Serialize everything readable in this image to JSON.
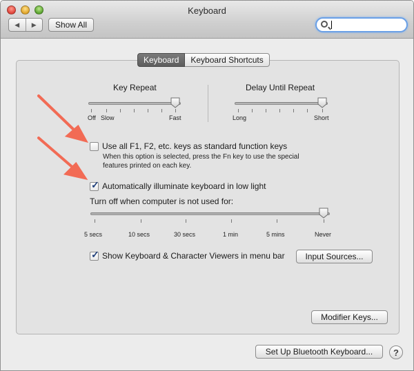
{
  "window": {
    "title": "Keyboard"
  },
  "toolbar": {
    "back_icon": "◀",
    "forward_icon": "▶",
    "show_all_label": "Show All",
    "search_value": ""
  },
  "tabs": [
    {
      "label": "Keyboard",
      "selected": true
    },
    {
      "label": "Keyboard Shortcuts",
      "selected": false
    }
  ],
  "key_repeat": {
    "title": "Key Repeat",
    "labels": {
      "off": "Off",
      "slow": "Slow",
      "fast": "Fast"
    },
    "value_fraction": 1.0
  },
  "delay_until_repeat": {
    "title": "Delay Until Repeat",
    "labels": {
      "long": "Long",
      "short": "Short"
    },
    "value_fraction": 1.0
  },
  "function_keys": {
    "label": "Use all F1, F2, etc. keys as standard function keys",
    "checked": false,
    "description_line1": "When this option is selected, press the Fn key to use the special",
    "description_line2": "features printed on each key."
  },
  "illuminate": {
    "label": "Automatically illuminate keyboard in low light",
    "checked": true,
    "turn_off_label": "Turn off when computer is not used for:",
    "ticks": [
      "5 secs",
      "10 secs",
      "30 secs",
      "1 min",
      "5 mins",
      "Never"
    ],
    "value_fraction": 1.0
  },
  "viewers": {
    "label": "Show Keyboard & Character Viewers in menu bar",
    "checked": true,
    "input_sources_label": "Input Sources..."
  },
  "buttons": {
    "modifier_keys": "Modifier Keys...",
    "bluetooth": "Set Up Bluetooth Keyboard...",
    "help": "?"
  },
  "colors": {
    "annotation_arrow": "#f26b55",
    "tab_selected": "#656565",
    "search_focus": "#6aa0e6"
  }
}
